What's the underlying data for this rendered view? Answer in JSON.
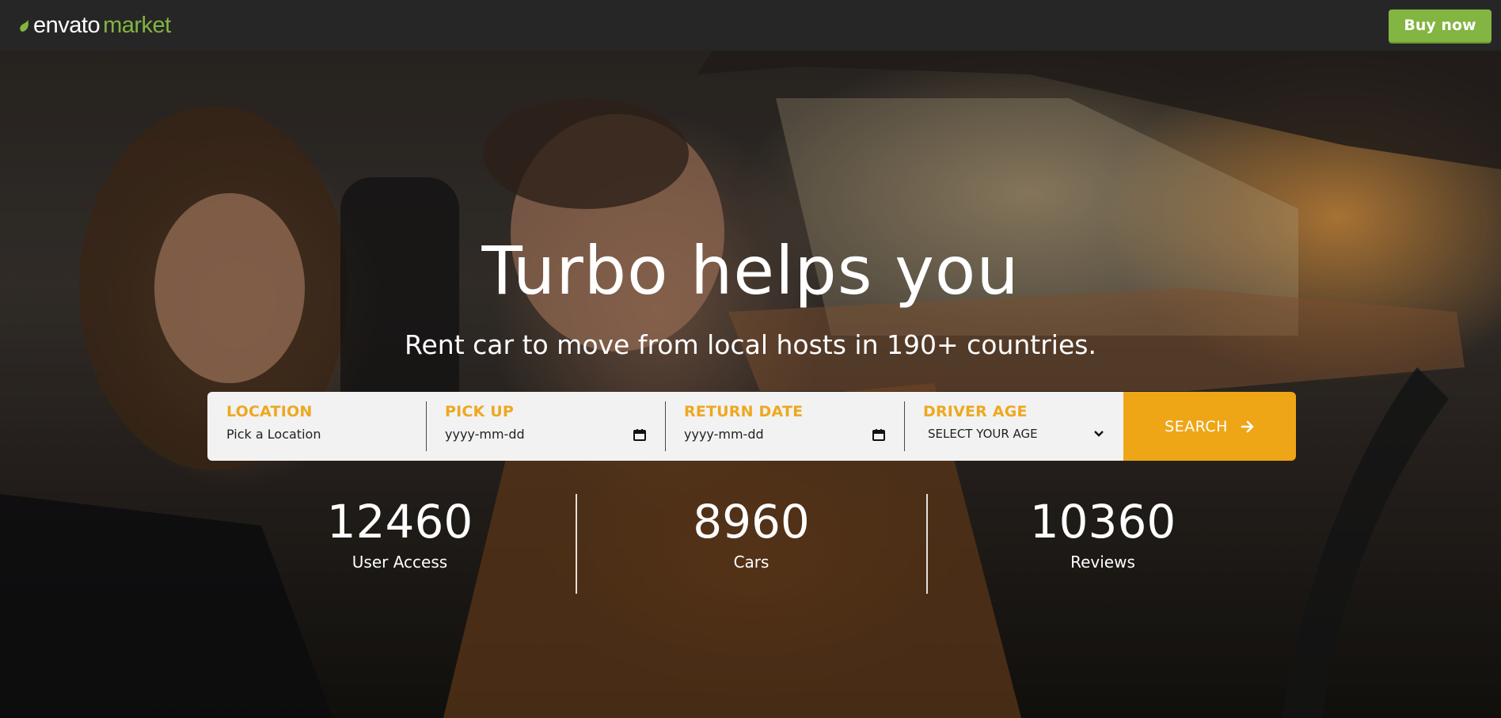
{
  "header": {
    "logo_primary": "envato",
    "logo_secondary": "market",
    "buy_label": "Buy now"
  },
  "hero": {
    "title": "Turbo helps you",
    "subtitle": "Rent car to move from local hosts in 190+ countries."
  },
  "search": {
    "location": {
      "label": "LOCATION",
      "placeholder": "Pick a Location"
    },
    "pickup": {
      "label": "PICK UP",
      "value": "yyyy-mm-dd"
    },
    "return": {
      "label": "RETURN DATE",
      "value": "yyyy-mm-dd"
    },
    "age": {
      "label": "DRIVER AGE",
      "selected": "SELECT YOUR AGE"
    },
    "button_label": "SEARCH"
  },
  "stats": [
    {
      "value": "12460",
      "label": "User Access"
    },
    {
      "value": "8960",
      "label": "Cars"
    },
    {
      "value": "10360",
      "label": "Reviews"
    }
  ],
  "colors": {
    "brand_green": "#82b541",
    "accent_orange": "#eea617",
    "topbar_bg": "#262626"
  },
  "icons": {
    "logo": "leaf-icon",
    "date": "calendar-icon",
    "select": "chevron-down-icon",
    "search": "arrow-right-icon"
  }
}
